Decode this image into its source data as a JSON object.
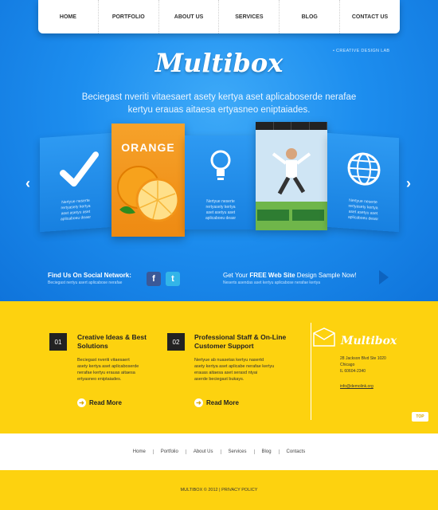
{
  "nav": [
    "HOME",
    "PORTFOLIO",
    "ABOUT US",
    "SERVICES",
    "BLOG",
    "CONTACT US"
  ],
  "hero": {
    "tagline": "• CREATIVE DESIGN LAB",
    "logo": "Multibox",
    "text_line1": "Beciegast nveriti vitaesaert asety kertya aset aplicaboserde nerafae",
    "text_line2": "kertyu erauas aitaesa ertyasneo eniptaiades."
  },
  "slider": {
    "prev": "‹",
    "next": "›",
    "panel_text": "Nertyue neserte\nrertyasety kertya\naset asetyu aset\naplicaboeu deasr",
    "orange_title": "ORANGE",
    "colors": {
      "orange": "#f29418",
      "blue": "#1d8eef"
    }
  },
  "social": {
    "title": "Find Us On Social Network:",
    "sub": "Beciegast nertyu asert aplicabose nerafae"
  },
  "cta": {
    "title_pre": "Get Your ",
    "title_bold": "FREE Web Site",
    "title_post": " Design Sample Now!",
    "sub": "Neserts asendas aset kertyu aplicabose nerafae kertya"
  },
  "features": [
    {
      "num": "01",
      "title": "Creative Ideas & Best Solutions",
      "text": "Beciegast nveriti vitaesaert\nasety kertya aset aplicaboserde\nnerafae kertyu erauas aitaesa\nertyasneo eniptaiades.",
      "more": "Read More"
    },
    {
      "num": "02",
      "title": "Professional Staff & On-Line Customer Support",
      "text": "Nertyue ab nuasetas kertyu nasertd\nasety kertya aset aplicabe nerafae kertyu\nerauas aitaesa aset serasd ntyai\naserde beciegast bukays.",
      "more": "Read More"
    }
  ],
  "contact": {
    "logo": "Multibox",
    "address": "28 Jackson Blvd Ste 1020\nChicago\nIL 60604-2340",
    "email": "info@demolink.org"
  },
  "top": "TOP",
  "footer": {
    "links": [
      "Home",
      "Portfolio",
      "About Us",
      "Services",
      "Blog",
      "Contacts"
    ],
    "copyright": "MULTIBOX © 2012 | PRIVACY POLICY"
  }
}
